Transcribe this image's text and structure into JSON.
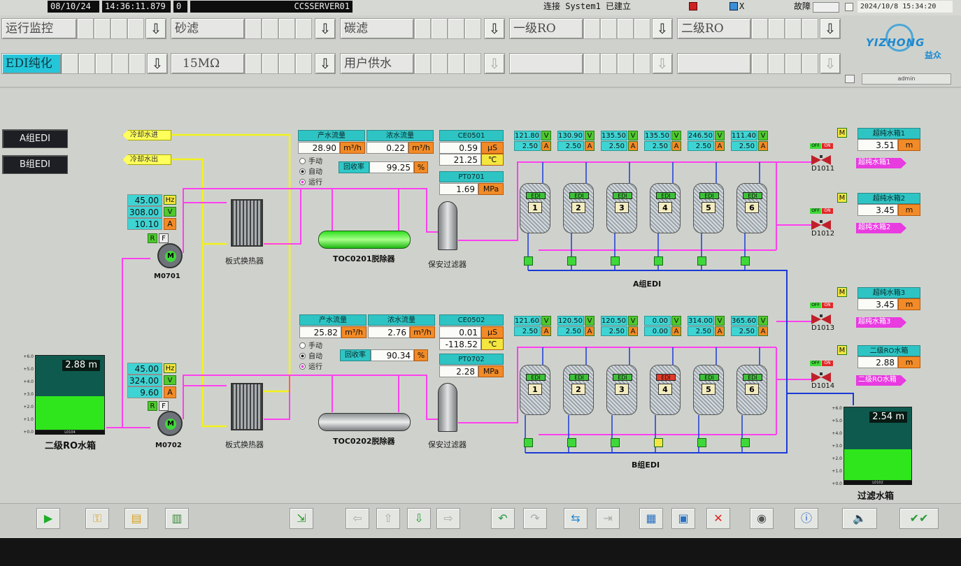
{
  "status": {
    "date": "08/10/24",
    "time": "14:36:11.879",
    "count": "0",
    "server": "CCSSERVER01",
    "connection": "连接 System1 已建立",
    "fault_label": "故障",
    "datetime": "2024/10/8 15:34:20",
    "close_mark": "X",
    "user": "admin"
  },
  "nav": {
    "row1": [
      "运行监控",
      "砂滤",
      "碳滤",
      "一级RO",
      "二级RO"
    ],
    "row2": [
      "EDI纯化",
      "15MΩ",
      "用户供水",
      "",
      ""
    ]
  },
  "logo": {
    "brand": "YIZHONG",
    "cn": "益众"
  },
  "side": {
    "group_a": "A组EDI",
    "group_b": "B组EDI"
  },
  "cooling": {
    "in": "冷却水进",
    "out": "冷却水出"
  },
  "pumps": [
    {
      "id": "M0701",
      "hz": "45.00",
      "v": "308.00",
      "a": "10.10",
      "glyph": "M",
      "r": "R",
      "f": "F"
    },
    {
      "id": "M0702",
      "hz": "45.00",
      "v": "324.00",
      "a": "9.60",
      "glyph": "M",
      "r": "R",
      "f": "F"
    }
  ],
  "units": {
    "hz": "Hz",
    "v": "V",
    "a": "A",
    "flow": "m³/h",
    "us": "μS",
    "c": "℃",
    "mpa": "MPa",
    "pct": "%",
    "m": "m"
  },
  "exchanger_label": "板式换热器",
  "filter_label": "保安过滤器",
  "modes": {
    "manual": "手动",
    "auto": "自动",
    "run": "运行"
  },
  "groupA": {
    "product_flow_label": "产水流量",
    "product_flow": "28.90",
    "conc_flow_label": "浓水流量",
    "conc_flow": "0.22",
    "recovery_label": "回收率",
    "recovery": "99.25",
    "ce_tag": "CE0501",
    "ce": "0.59",
    "temp": "21.25",
    "pt_tag": "PT0701",
    "pt": "1.69",
    "toc": "TOC0201脱除器",
    "title": "A组EDI",
    "modules": [
      {
        "n": "1",
        "v": "121.80",
        "a": "2.50",
        "state": "ok"
      },
      {
        "n": "2",
        "v": "130.90",
        "a": "2.50",
        "state": "ok"
      },
      {
        "n": "3",
        "v": "135.50",
        "a": "2.50",
        "state": "ok"
      },
      {
        "n": "4",
        "v": "135.50",
        "a": "2.50",
        "state": "ok"
      },
      {
        "n": "5",
        "v": "246.50",
        "a": "2.50",
        "state": "ok"
      },
      {
        "n": "6",
        "v": "111.40",
        "a": "2.50",
        "state": "ok"
      }
    ]
  },
  "groupB": {
    "product_flow_label": "产水流量",
    "product_flow": "25.82",
    "conc_flow_label": "浓水流量",
    "conc_flow": "2.76",
    "recovery_label": "回收率",
    "recovery": "90.34",
    "ce_tag": "CE0502",
    "ce": "0.01",
    "temp": "-118.52",
    "pt_tag": "PT0702",
    "pt": "2.28",
    "toc": "TOC0202脱除器",
    "title": "B组EDI",
    "modules": [
      {
        "n": "1",
        "v": "121.60",
        "a": "2.50",
        "state": "ok"
      },
      {
        "n": "2",
        "v": "120.50",
        "a": "2.50",
        "state": "ok"
      },
      {
        "n": "3",
        "v": "120.50",
        "a": "2.50",
        "state": "ok"
      },
      {
        "n": "4",
        "v": "0.00",
        "a": "0.00",
        "state": "fault"
      },
      {
        "n": "5",
        "v": "314.00",
        "a": "2.50",
        "state": "ok"
      },
      {
        "n": "6",
        "v": "365.60",
        "a": "2.50",
        "state": "ok"
      }
    ]
  },
  "edi_tag": "EDI",
  "valves": [
    {
      "id": "D1011",
      "label": "超纯水箱1",
      "level": "3.51",
      "target": "超纯水箱1",
      "off": "OFF",
      "on": "ON",
      "mode": "M"
    },
    {
      "id": "D1012",
      "label": "超纯水箱2",
      "level": "3.45",
      "target": "超纯水箱2",
      "off": "OFF",
      "on": "ON",
      "mode": "M"
    },
    {
      "id": "D1013",
      "label": "超纯水箱3",
      "level": "3.45",
      "target": "超纯水箱3",
      "off": "OFF",
      "on": "ON",
      "mode": "M"
    },
    {
      "id": "D1014",
      "label": "二级RO水箱",
      "level": "2.88",
      "target": "二级RO水箱",
      "off": "OFF",
      "on": "ON",
      "mode": "M"
    }
  ],
  "tanks": {
    "ro2": {
      "level": "2.88",
      "tag": "L0104",
      "name": "二级RO水箱",
      "fill_ratio": 0.45
    },
    "filter": {
      "level": "2.54",
      "tag": "L0102",
      "name": "过滤水箱",
      "fill_ratio": 0.42
    },
    "scale": [
      "+6.0",
      "+5.0",
      "+4.0",
      "+3.0",
      "+2.0",
      "+1.0",
      "+0.0"
    ]
  },
  "colors": {
    "pipe_pink": "#ff3ff0",
    "pipe_yellow": "#f2f21a",
    "pipe_blue": "#1a3ad6",
    "accent_cyan": "#2fc4c4",
    "alarm_orange": "#f28b27",
    "tank_green": "#2fe61c"
  }
}
